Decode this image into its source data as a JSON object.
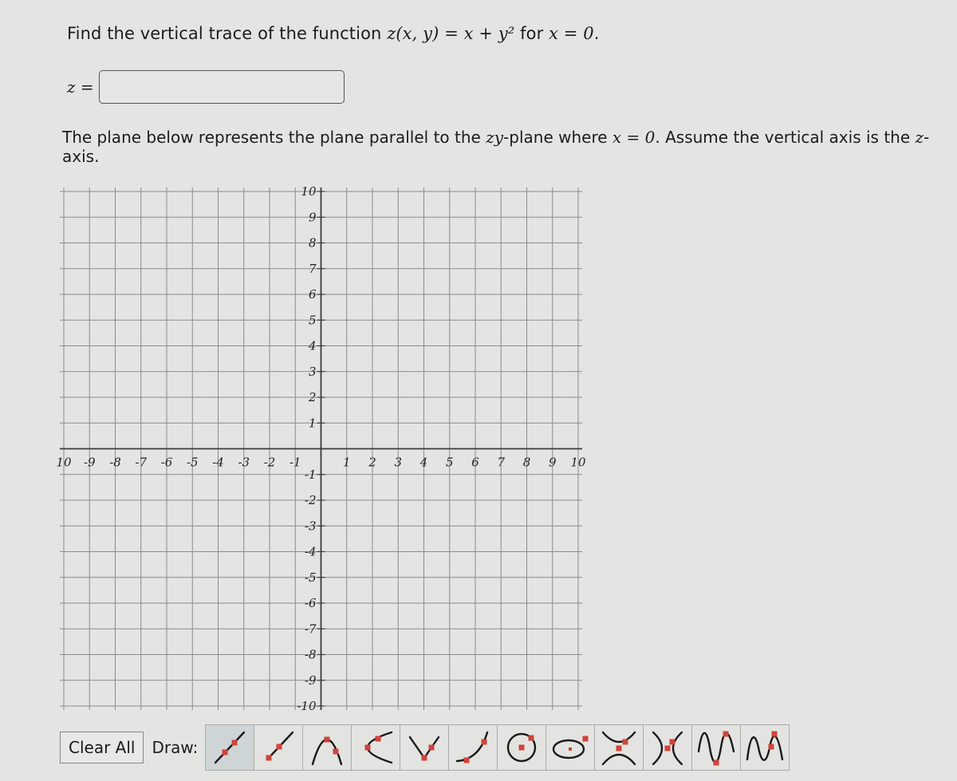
{
  "question": {
    "prefix": "Find the vertical trace of the function ",
    "function_expr": "z(x, y) = x + y²",
    "mid": " for ",
    "condition": "x = 0",
    "suffix": "."
  },
  "answer": {
    "label": "z =",
    "value": "",
    "placeholder": ""
  },
  "description": {
    "part1": "The plane below represents the plane parallel to the ",
    "plane_name": "zy",
    "part2": "-plane where ",
    "condition": "x = 0",
    "part3": ". Assume the vertical axis is the ",
    "axis_name": "z",
    "part4": "-axis."
  },
  "graph": {
    "x_range": [
      -10,
      10
    ],
    "y_range": [
      -10,
      10
    ],
    "grid_step": 1,
    "x_tick_labels": [
      "10",
      "-9",
      "-8",
      "-7",
      "-6",
      "-5",
      "-4",
      "-3",
      "-2",
      "-1",
      "1",
      "2",
      "3",
      "4",
      "5",
      "6",
      "7",
      "8",
      "9",
      "10"
    ],
    "y_tick_labels": [
      "10",
      "9",
      "8",
      "7",
      "6",
      "5",
      "4",
      "3",
      "2",
      "1",
      "-1",
      "-2",
      "-3",
      "-4",
      "-5",
      "-6",
      "-7",
      "-8",
      "-9",
      "-10"
    ],
    "grid_color": "#8a8c8a",
    "axis_color": "#3a3a3a"
  },
  "toolbar": {
    "clear_label": "Clear All",
    "draw_label": "Draw:",
    "marker_color": "#d0433a",
    "tools": [
      {
        "name": "line",
        "icon": "line-tool-icon",
        "selected": true
      },
      {
        "name": "ray",
        "icon": "ray-tool-icon",
        "selected": false
      },
      {
        "name": "parabola-vertical",
        "icon": "parabola-down-tool-icon",
        "selected": false
      },
      {
        "name": "parabola-horizontal",
        "icon": "parabola-sideways-tool-icon",
        "selected": false
      },
      {
        "name": "absolute-value",
        "icon": "absolute-value-tool-icon",
        "selected": false
      },
      {
        "name": "exponential",
        "icon": "exponential-tool-icon",
        "selected": false
      },
      {
        "name": "circle",
        "icon": "circle-tool-icon",
        "selected": false
      },
      {
        "name": "ellipse",
        "icon": "ellipse-tool-icon",
        "selected": false
      },
      {
        "name": "hyperbola-vertical",
        "icon": "hyperbola-vertical-tool-icon",
        "selected": false
      },
      {
        "name": "hyperbola-horizontal",
        "icon": "hyperbola-horizontal-tool-icon",
        "selected": false
      },
      {
        "name": "sine",
        "icon": "sine-tool-icon",
        "selected": false
      },
      {
        "name": "cosine",
        "icon": "cosine-tool-icon",
        "selected": false
      }
    ]
  }
}
